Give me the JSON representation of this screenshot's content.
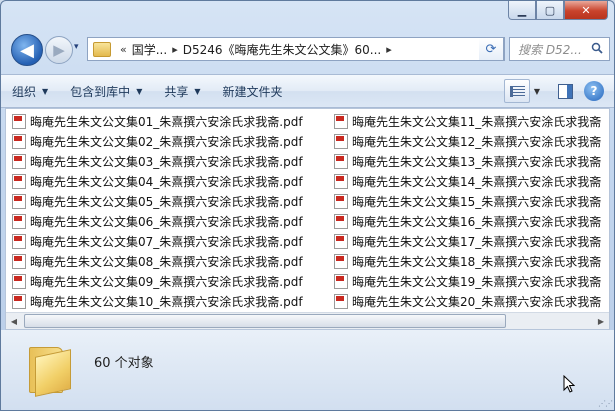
{
  "window": {
    "caption": {
      "minimize": "▁",
      "maximize": "▢",
      "close": "✕"
    }
  },
  "nav": {
    "back_glyph": "◀",
    "forward_glyph": "▶",
    "history_glyph": "▾",
    "breadcrumb": {
      "overflow": "«",
      "items": [
        "国学...",
        "D5246《晦庵先生朱文公文集》60..."
      ],
      "separator": "▸"
    },
    "refresh_glyph": "⟳",
    "search_placeholder": "搜索 D52...",
    "search_icon": "search-icon"
  },
  "toolbar": {
    "organize": "组织",
    "include_in_library": "包含到库中",
    "share": "共享",
    "new_folder": "新建文件夹",
    "help": "?"
  },
  "files_col1": [
    "晦庵先生朱文公文集01_朱熹撰六安涂氏求我斋.pdf",
    "晦庵先生朱文公文集02_朱熹撰六安涂氏求我斋.pdf",
    "晦庵先生朱文公文集03_朱熹撰六安涂氏求我斋.pdf",
    "晦庵先生朱文公文集04_朱熹撰六安涂氏求我斋.pdf",
    "晦庵先生朱文公文集05_朱熹撰六安涂氏求我斋.pdf",
    "晦庵先生朱文公文集06_朱熹撰六安涂氏求我斋.pdf",
    "晦庵先生朱文公文集07_朱熹撰六安涂氏求我斋.pdf",
    "晦庵先生朱文公文集08_朱熹撰六安涂氏求我斋.pdf",
    "晦庵先生朱文公文集09_朱熹撰六安涂氏求我斋.pdf",
    "晦庵先生朱文公文集10_朱熹撰六安涂氏求我斋.pdf"
  ],
  "files_col2": [
    "晦庵先生朱文公文集11_朱熹撰六安涂氏求我斋",
    "晦庵先生朱文公文集12_朱熹撰六安涂氏求我斋",
    "晦庵先生朱文公文集13_朱熹撰六安涂氏求我斋",
    "晦庵先生朱文公文集14_朱熹撰六安涂氏求我斋",
    "晦庵先生朱文公文集15_朱熹撰六安涂氏求我斋",
    "晦庵先生朱文公文集16_朱熹撰六安涂氏求我斋",
    "晦庵先生朱文公文集17_朱熹撰六安涂氏求我斋",
    "晦庵先生朱文公文集18_朱熹撰六安涂氏求我斋",
    "晦庵先生朱文公文集19_朱熹撰六安涂氏求我斋",
    "晦庵先生朱文公文集20_朱熹撰六安涂氏求我斋"
  ],
  "file_icon": "pdf-file-icon",
  "details": {
    "count_text": "60 个对象",
    "icon": "folder-icon"
  },
  "colors": {
    "accent": "#2560b3",
    "pdf_red": "#c8281f",
    "toolbar_text": "#1e395b"
  }
}
